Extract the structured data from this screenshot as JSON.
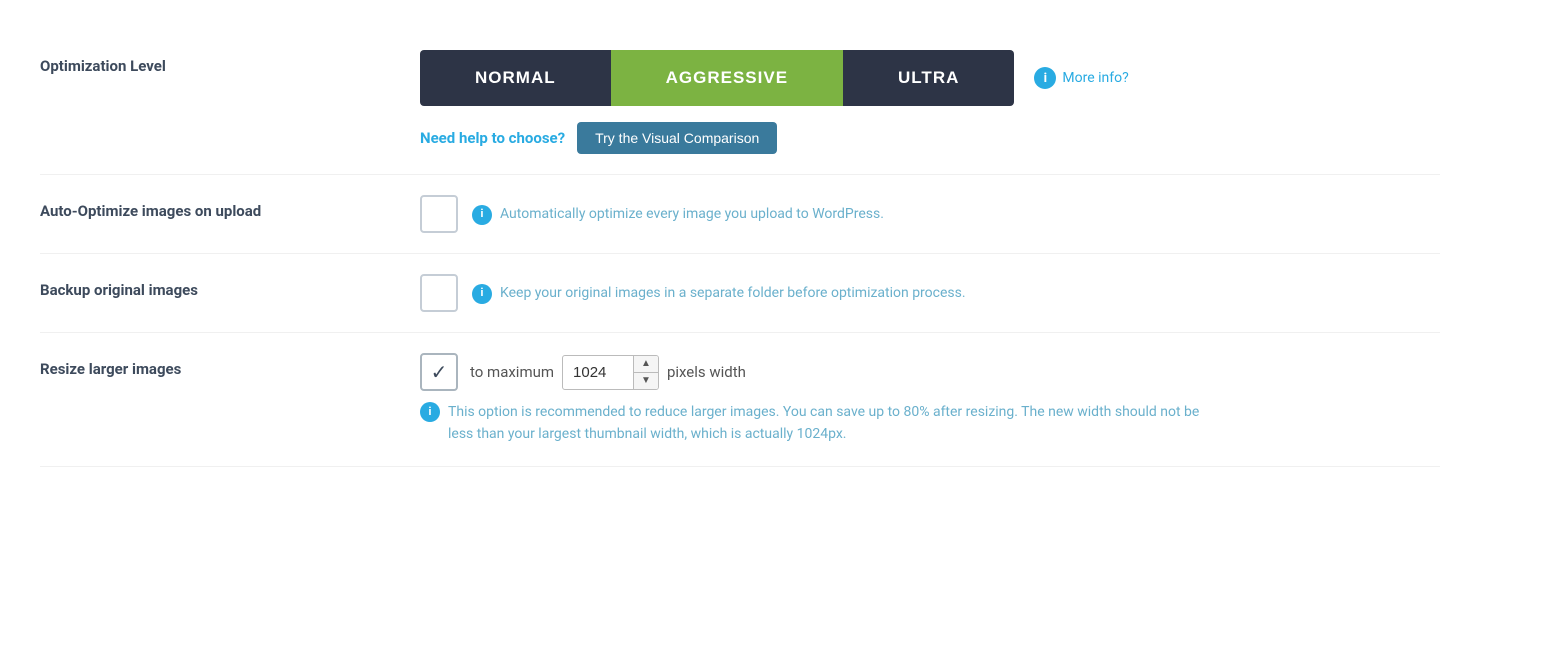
{
  "optimization_level": {
    "label": "Optimization Level",
    "buttons": [
      {
        "id": "normal",
        "label": "NORMAL",
        "active": false
      },
      {
        "id": "aggressive",
        "label": "AGGRESSIVE",
        "active": true
      },
      {
        "id": "ultra",
        "label": "ULTRA",
        "active": false
      }
    ],
    "more_info_label": "More info?",
    "need_help_text": "Need help to choose?",
    "visual_comparison_label": "Try the Visual Comparison"
  },
  "auto_optimize": {
    "label": "Auto-Optimize images on upload",
    "checked": false,
    "description": "Automatically optimize every image you upload to WordPress."
  },
  "backup": {
    "label": "Backup original images",
    "checked": false,
    "description": "Keep your original images in a separate folder before optimization process."
  },
  "resize": {
    "label": "Resize larger images",
    "checked": true,
    "checkmark": "✓",
    "prefix_text": "to maximum",
    "pixel_value": "1024",
    "suffix_text": "pixels width",
    "note": "This option is recommended to reduce larger images. You can save up to 80% after resizing. The new width should not be less than your largest thumbnail width, which is actually 1024px.",
    "info_icon": "i"
  },
  "icons": {
    "info": "i",
    "checkmark": "✓",
    "arrow_up": "▲",
    "arrow_down": "▼"
  }
}
